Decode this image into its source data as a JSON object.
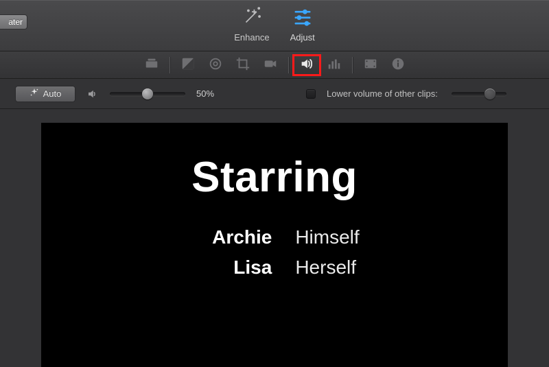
{
  "top": {
    "theater_label": "ater",
    "tools": {
      "enhance": "Enhance",
      "adjust": "Adjust"
    }
  },
  "volume": {
    "auto_label": "Auto",
    "percent_label": "50%",
    "slider_pos_pct": 50,
    "lower_label": "Lower volume of other clips:",
    "lower_checked": false,
    "lower_slider_pos_pct": 70
  },
  "preview": {
    "title": "Starring",
    "credits": [
      {
        "name": "Archie",
        "role": "Himself"
      },
      {
        "name": "Lisa",
        "role": "Herself"
      }
    ]
  }
}
